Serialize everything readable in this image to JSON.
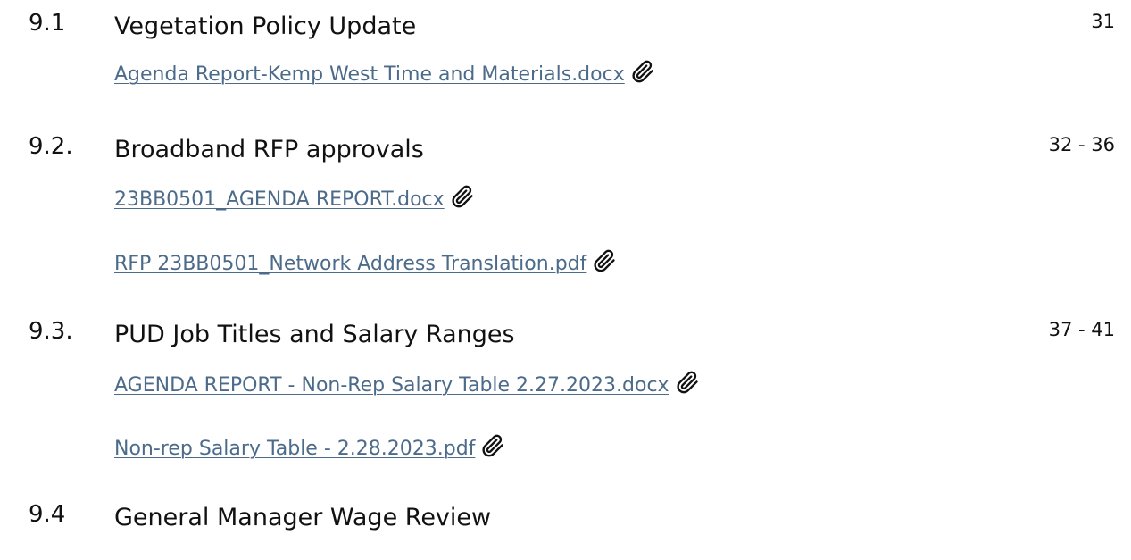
{
  "items": [
    {
      "number": "9.1",
      "title": "Vegetation Policy Update",
      "pages": "31",
      "attachments": [
        {
          "label": "Agenda Report-Kemp West Time and Materials.docx",
          "icon": "paperclip-icon"
        }
      ]
    },
    {
      "number": "9.2.",
      "title": "Broadband RFP approvals",
      "pages": "32 - 36",
      "attachments": [
        {
          "label": "23BB0501_AGENDA REPORT.docx",
          "icon": "paperclip-icon"
        },
        {
          "label": "RFP 23BB0501_Network Address Translation.pdf",
          "icon": "paperclip-icon"
        }
      ]
    },
    {
      "number": "9.3.",
      "title": "PUD Job Titles and Salary Ranges",
      "pages": "37 - 41",
      "attachments": [
        {
          "label": "AGENDA REPORT - Non-Rep Salary Table 2.27.2023.docx",
          "icon": "paperclip-icon"
        },
        {
          "label": "Non-rep Salary Table - 2.28.2023.pdf",
          "icon": "paperclip-icon"
        }
      ]
    },
    {
      "number": "9.4",
      "title": "General Manager Wage Review",
      "pages": "",
      "attachments": []
    }
  ],
  "colors": {
    "link": "#4c6b8a",
    "text": "#111111"
  }
}
